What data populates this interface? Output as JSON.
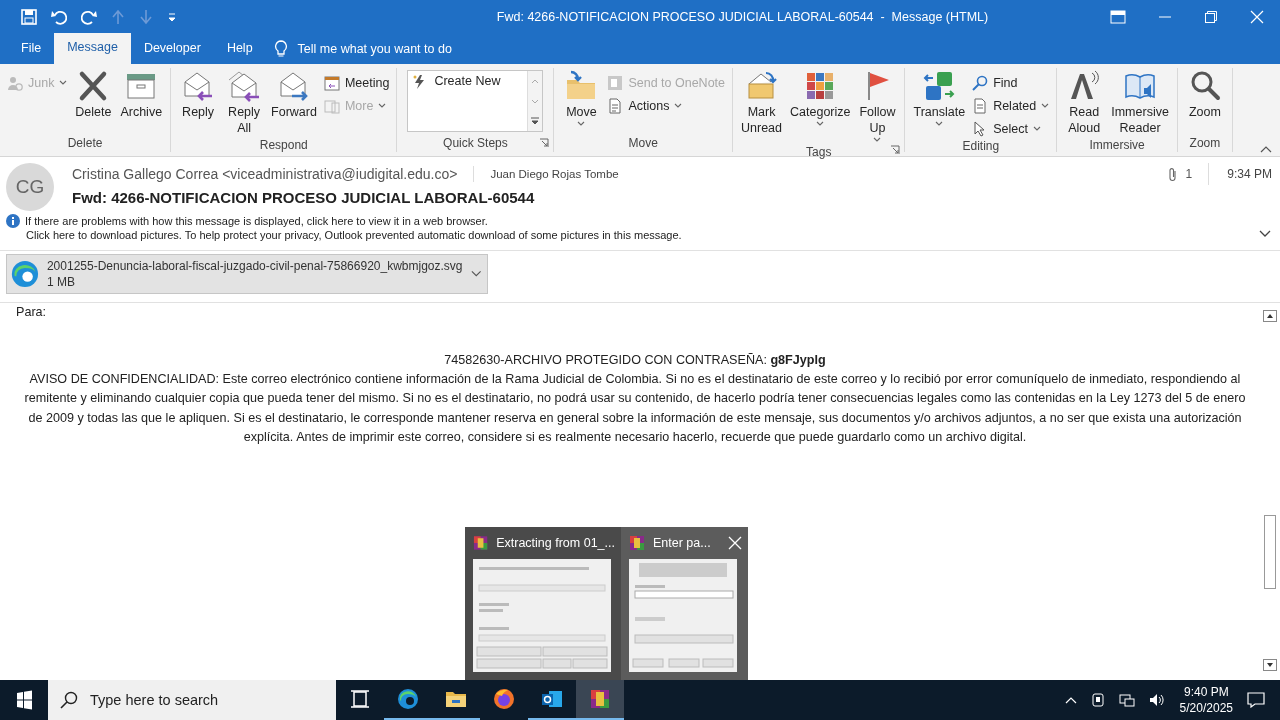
{
  "window": {
    "title": "Fwd: 4266-NOTIFICACION PROCESO JUDICIAL LABORAL-60544  -  Message (HTML)"
  },
  "menu_tabs": [
    {
      "label": "File",
      "selected": false
    },
    {
      "label": "Message",
      "selected": true
    },
    {
      "label": "Developer",
      "selected": false
    },
    {
      "label": "Help",
      "selected": false
    }
  ],
  "tell_me": {
    "placeholder": "Tell me what you want to do"
  },
  "ribbon": {
    "groups": [
      {
        "label": "Delete",
        "launcher": false,
        "buttons": [
          {
            "kind": "small",
            "label": "Junk",
            "disabled": true,
            "dropdown": true
          },
          {
            "kind": "large",
            "label": "Delete",
            "disabled": false,
            "dropdown": false
          },
          {
            "kind": "large",
            "label": "Archive",
            "disabled": false,
            "dropdown": false
          }
        ]
      },
      {
        "label": "Respond",
        "launcher": false,
        "buttons": [
          {
            "kind": "large",
            "label": "Reply",
            "disabled": false,
            "dropdown": false
          },
          {
            "kind": "large",
            "label": "Reply\nAll",
            "disabled": false,
            "dropdown": false
          },
          {
            "kind": "large",
            "label": "Forward",
            "disabled": false,
            "dropdown": false
          },
          {
            "kind": "small",
            "label": "Meeting",
            "disabled": false,
            "dropdown": false
          },
          {
            "kind": "small",
            "label": "More",
            "disabled": true,
            "dropdown": true
          }
        ]
      },
      {
        "label": "Quick Steps",
        "launcher": true,
        "buttons": [
          {
            "kind": "gallery",
            "label": "Create New",
            "disabled": false
          }
        ]
      },
      {
        "label": "Move",
        "launcher": false,
        "buttons": [
          {
            "kind": "large",
            "label": "Move",
            "disabled": false,
            "dropdown": true
          },
          {
            "kind": "small",
            "label": "Send to OneNote",
            "disabled": true,
            "dropdown": false
          },
          {
            "kind": "small",
            "label": "Actions",
            "disabled": false,
            "dropdown": true
          }
        ]
      },
      {
        "label": "Tags",
        "launcher": true,
        "buttons": [
          {
            "kind": "large",
            "label": "Mark\nUnread",
            "disabled": false,
            "dropdown": false
          },
          {
            "kind": "large",
            "label": "Categorize",
            "disabled": false,
            "dropdown": true
          },
          {
            "kind": "large",
            "label": "Follow\nUp",
            "disabled": false,
            "dropdown": true
          }
        ]
      },
      {
        "label": "Editing",
        "launcher": false,
        "buttons": [
          {
            "kind": "large",
            "label": "Translate",
            "disabled": false,
            "dropdown": true
          },
          {
            "kind": "small",
            "label": "Find",
            "disabled": false,
            "dropdown": false
          },
          {
            "kind": "small",
            "label": "Related",
            "disabled": false,
            "dropdown": true
          },
          {
            "kind": "small",
            "label": "Select",
            "disabled": false,
            "dropdown": true
          }
        ]
      },
      {
        "label": "Immersive",
        "launcher": false,
        "buttons": [
          {
            "kind": "large",
            "label": "Read\nAloud",
            "disabled": false,
            "dropdown": false
          },
          {
            "kind": "large",
            "label": "Immersive\nReader",
            "disabled": false,
            "dropdown": false
          }
        ]
      },
      {
        "label": "Zoom",
        "launcher": false,
        "buttons": [
          {
            "kind": "large",
            "label": "Zoom",
            "disabled": false,
            "dropdown": false
          }
        ]
      }
    ]
  },
  "header": {
    "avatar": "CG",
    "sender": "Cristina Gallego Correa <viceadministrativa@iudigital.edu.co>",
    "recipient": "Juan Diego Rojas Tombe",
    "attachment_count": "1",
    "time": "9:34 PM",
    "subject": "Fwd: 4266-NOTIFICACION PROCESO JUDICIAL LABORAL-60544",
    "info_lines": [
      "If there are problems with how this message is displayed, click here to view it in a web browser.",
      "Click here to download pictures. To help protect your privacy, Outlook prevented automatic download of some pictures in this message."
    ]
  },
  "attachment": {
    "name": "2001255-Denuncia-laboral-fiscal-juzgado-civil-penal-75866920_kwbmjgoz.svg",
    "size": "1 MB"
  },
  "body": {
    "to_label": "Para:",
    "password_line": "74582630-ARCHIVO  PROTEGIDO CON CONTRASEÑA: **g8FJyplg**",
    "notice": "AVISO DE CONFIDENCIALIDAD: Este correo electrónico contiene información de la Rama Judicial de Colombia. Si no es el destinatario de este correo y lo recibió por error comuníquelo de inmediato, respondiendo al remitente y eliminando cualquier copia que pueda tener del mismo. Si no es el destinatario, no podrá usar su contenido, de hacerlo podría tener consecuencias legales como las contenidas en la Ley 1273  del 5 de enero de 2009  y todas las que le apliquen. Si es el destinatario, le corresponde mantener reserva en general sobre la información de este mensaje, sus documentos y/o archivos adjuntos, a no ser que exista una autorización explícita. Antes de imprimir este correo, considere si es realmente necesario hacerlo, recuerde que puede guardarlo como un archivo digital."
  },
  "taskbar_preview": {
    "windows": [
      {
        "title": "Extracting from 01_...",
        "kind": "progress",
        "closable": false
      },
      {
        "title": "Enter pa...",
        "kind": "password",
        "closable": true
      }
    ]
  },
  "taskbar": {
    "search": {
      "placeholder": "Type here to search"
    },
    "apps": [
      {
        "kind": "taskview",
        "running": false,
        "selected": false
      },
      {
        "kind": "edge",
        "running": true,
        "selected": false
      },
      {
        "kind": "explorer",
        "running": true,
        "selected": false
      },
      {
        "kind": "firefox",
        "running": false,
        "selected": false
      },
      {
        "kind": "outlook",
        "running": true,
        "selected": false
      },
      {
        "kind": "winrar",
        "running": true,
        "selected": true
      }
    ],
    "time": "9:40 PM",
    "date": "5/20/2025"
  }
}
